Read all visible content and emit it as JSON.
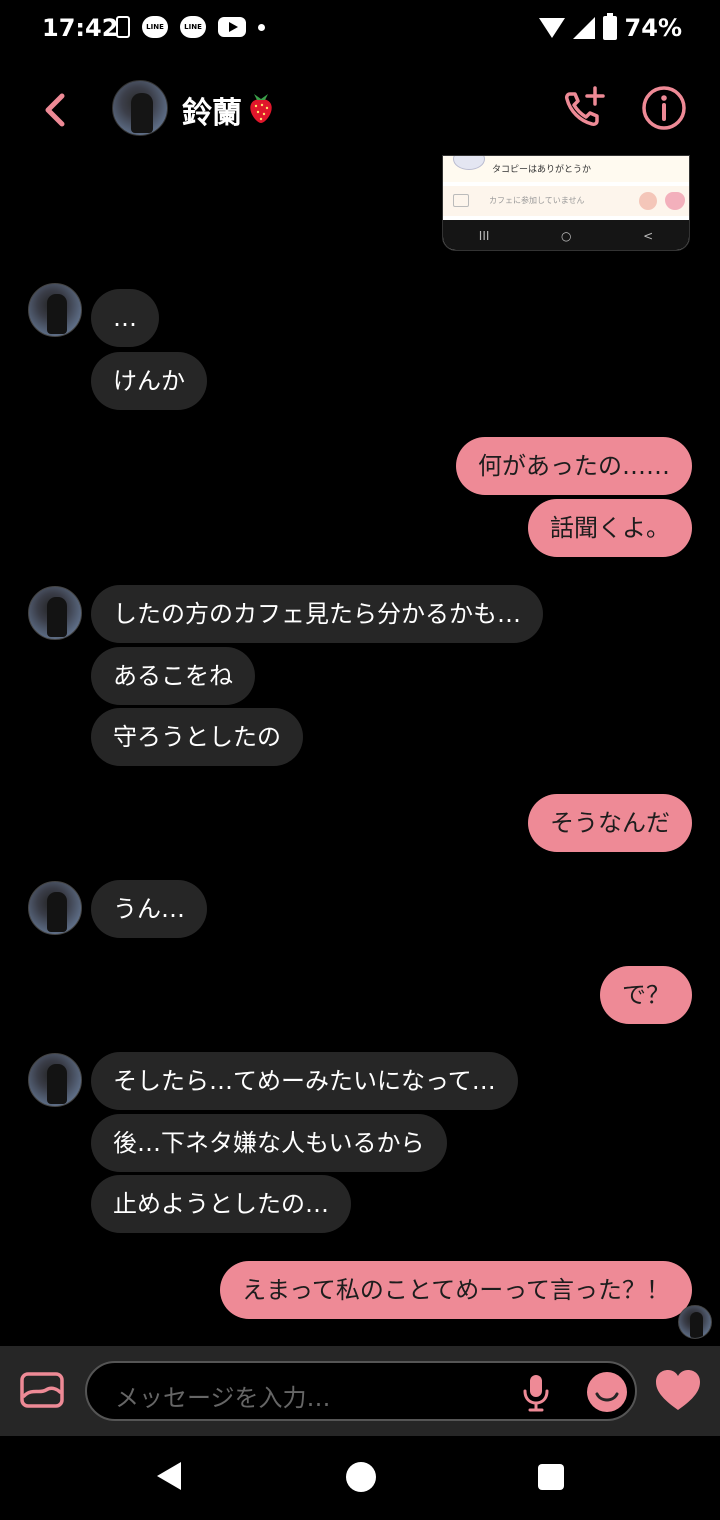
{
  "status_bar": {
    "time": "17:42",
    "line_label": "LINE",
    "battery": "74%"
  },
  "header": {
    "contact_name": "鈴蘭"
  },
  "shared_image": {
    "line1": "タコピーはありがとうか",
    "line2": "カフェに参加していません",
    "nav": [
      "III",
      "○",
      "<"
    ]
  },
  "messages": [
    {
      "side": "in",
      "text": "…"
    },
    {
      "side": "in",
      "text": "けんか"
    },
    {
      "side": "out",
      "text": "何があったの……"
    },
    {
      "side": "out",
      "text": "話聞くよ。"
    },
    {
      "side": "in",
      "text": "したの方のカフェ見たら分かるかも…"
    },
    {
      "side": "in",
      "text": "あるこをね"
    },
    {
      "side": "in",
      "text": "守ろうとしたの"
    },
    {
      "side": "out",
      "text": "そうなんだ"
    },
    {
      "side": "in",
      "text": "うん…"
    },
    {
      "side": "out",
      "text": "で？"
    },
    {
      "side": "in",
      "text": "そしたら…てめーみたいになって…"
    },
    {
      "side": "in",
      "text": "後…下ネタ嫌な人もいるから"
    },
    {
      "side": "in",
      "text": "止めようとしたの…"
    },
    {
      "side": "out",
      "text": "えまって私のことてめーって言った？！"
    }
  ],
  "input": {
    "placeholder": "メッセージを入力…"
  },
  "colors": {
    "accent": "#ee8a96",
    "incoming_bubble": "#262626",
    "background": "#000000"
  },
  "icons": [
    "back-icon",
    "strawberry-icon",
    "call-add-icon",
    "info-icon",
    "gallery-icon",
    "mic-icon",
    "emoji-icon",
    "heart-icon"
  ]
}
